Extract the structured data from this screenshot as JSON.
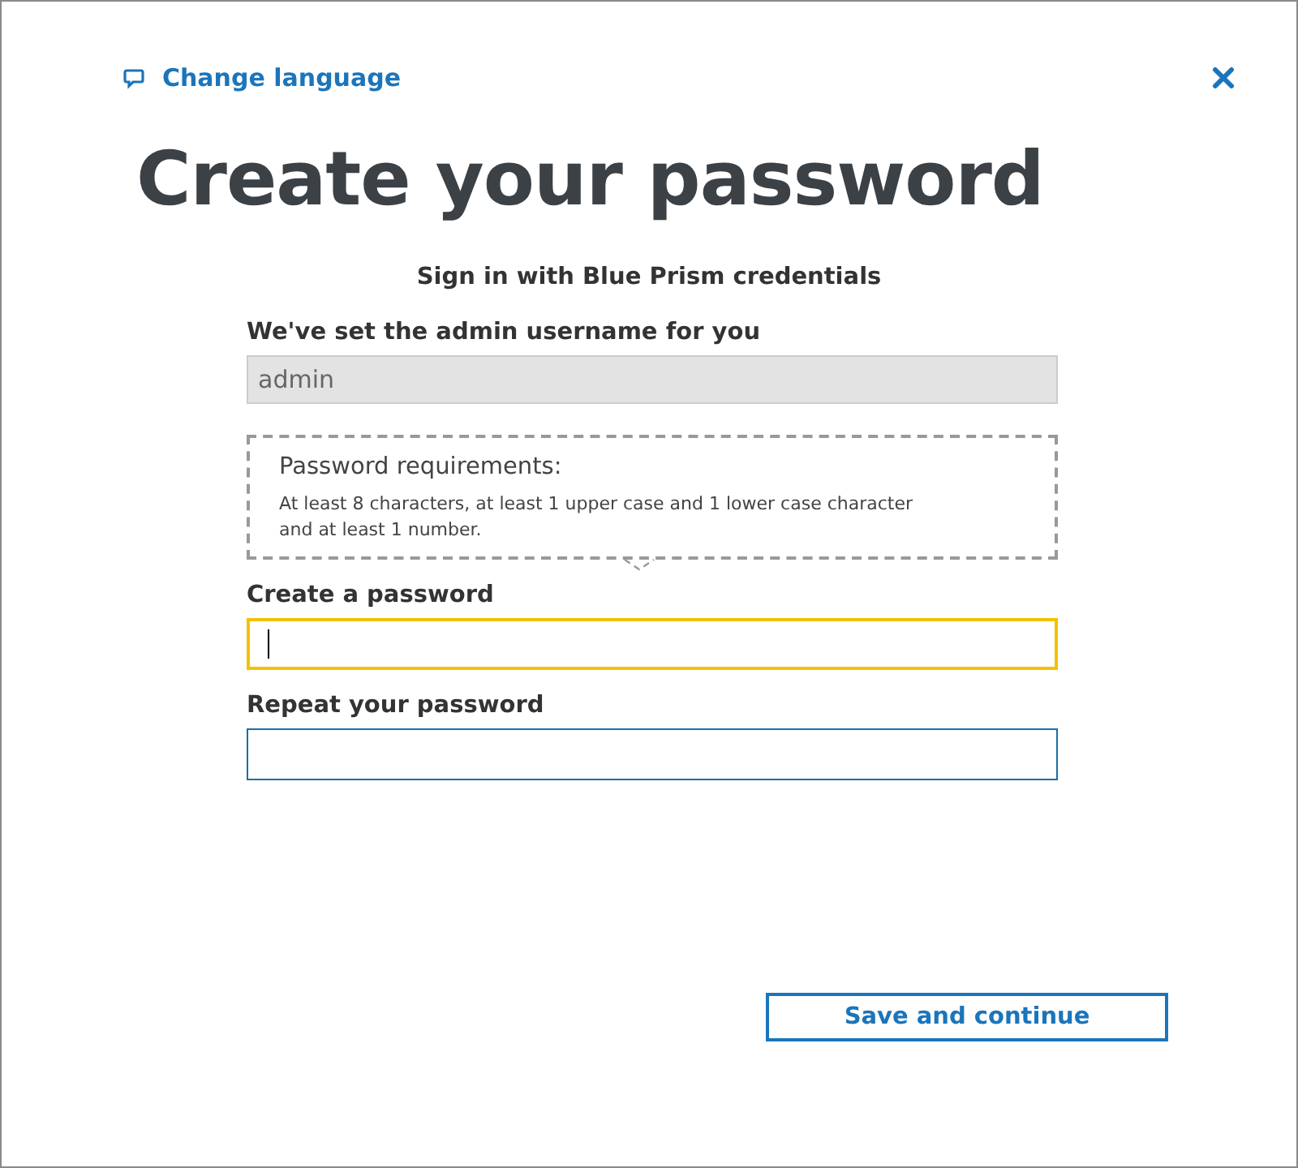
{
  "language_link": "Change language",
  "title": "Create your password",
  "subtitle": "Sign in with Blue Prism credentials",
  "username": {
    "label": "We've set the admin username for you",
    "value": "admin",
    "disabled": true
  },
  "requirements": {
    "heading": "Password requirements:",
    "text": "At least 8 characters, at least 1 upper case and 1 lower case character and at least 1 number."
  },
  "password_fields": [
    {
      "label": "Create a password",
      "focused": true
    },
    {
      "label": "Repeat your password",
      "focused": false
    }
  ],
  "save_button": "Save and continue"
}
